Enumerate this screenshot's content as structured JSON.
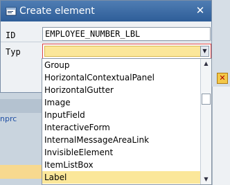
{
  "background": {
    "link_text": "nprc"
  },
  "dialog": {
    "title": "Create element",
    "close_label": "✕",
    "fields": {
      "id_label": "ID",
      "id_value": "EMPLOYEE_NUMBER_LBL",
      "typ_label": "Typ",
      "typ_value": ""
    }
  },
  "dropdown": {
    "items": [
      "Group",
      "HorizontalContextualPanel",
      "HorizontalGutter",
      "Image",
      "InputField",
      "InteractiveForm",
      "InternalMessageAreaLink",
      "InvisibleElement",
      "ItemListBox",
      "Label"
    ],
    "selected_index": 9
  },
  "colors": {
    "titlebar": "#2e5d98",
    "selection_highlight": "#fbe79a",
    "error_border": "#d44"
  },
  "icons": {
    "title_icon": "create-element-icon",
    "dropdown_arrow": "chevron-down-icon",
    "scroll_up": "scroll-up-icon",
    "scroll_down": "scroll-down-icon"
  }
}
